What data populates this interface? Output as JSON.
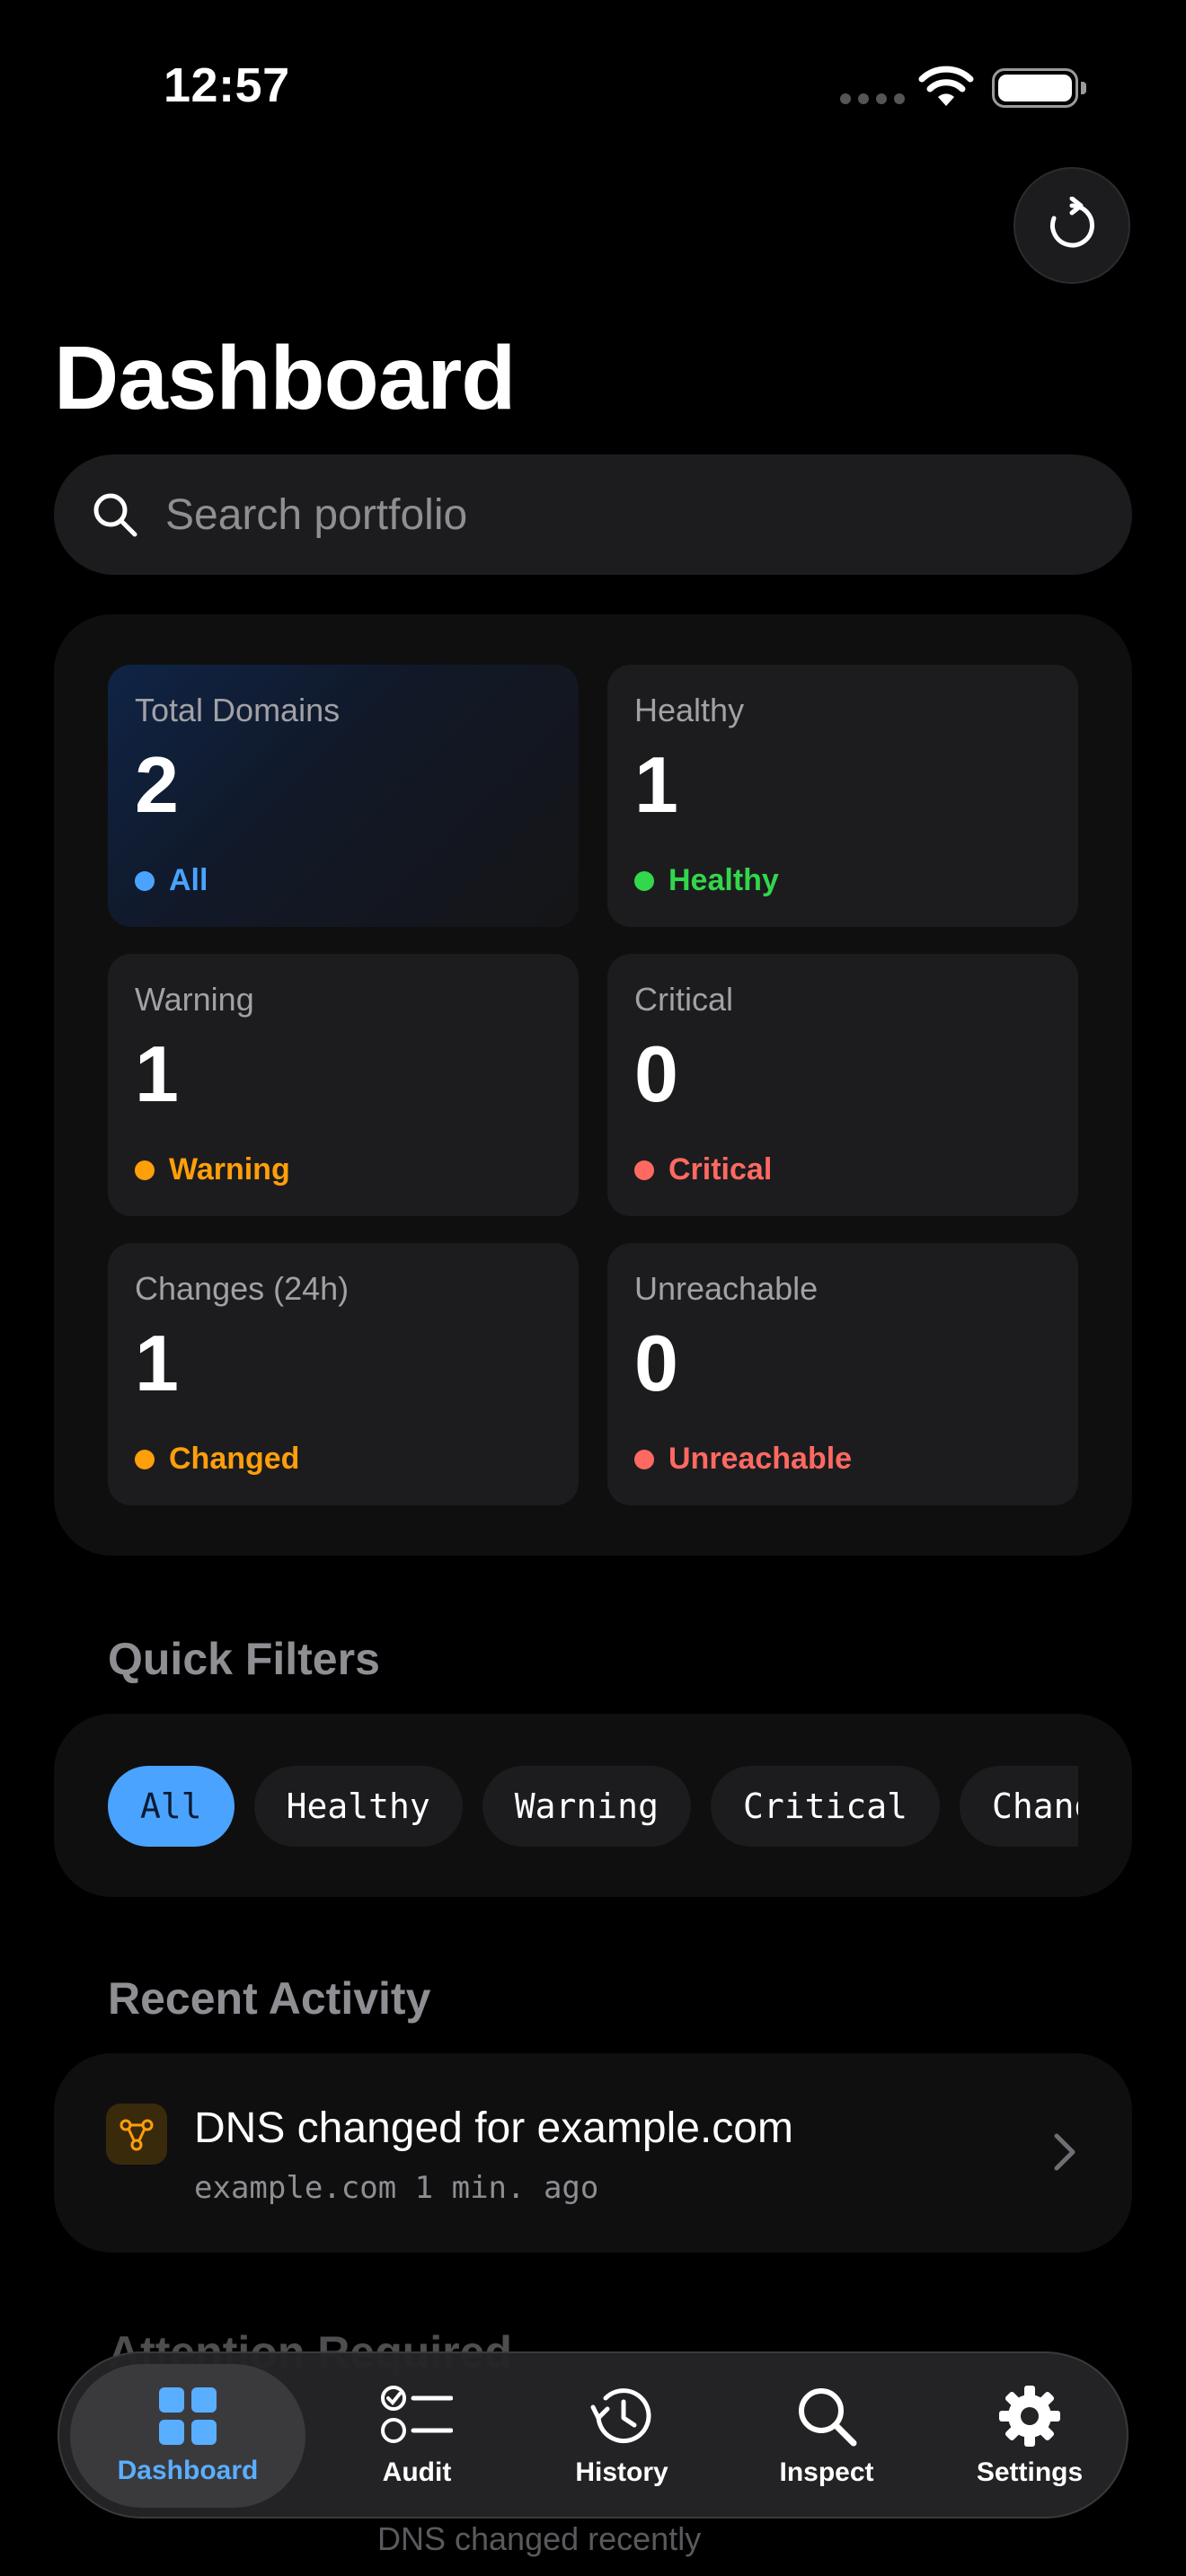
{
  "status_bar": {
    "time": "12:57"
  },
  "header": {
    "title": "Dashboard"
  },
  "search": {
    "placeholder": "Search portfolio"
  },
  "stats": [
    {
      "label": "Total Domains",
      "value": "2",
      "tag": "All",
      "color": "#4aa3ff"
    },
    {
      "label": "Healthy",
      "value": "1",
      "tag": "Healthy",
      "color": "#32d74b"
    },
    {
      "label": "Warning",
      "value": "1",
      "tag": "Warning",
      "color": "#ff9f0a"
    },
    {
      "label": "Critical",
      "value": "0",
      "tag": "Critical",
      "color": "#ff6961"
    },
    {
      "label": "Changes (24h)",
      "value": "1",
      "tag": "Changed",
      "color": "#ff9f0a"
    },
    {
      "label": "Unreachable",
      "value": "0",
      "tag": "Unreachable",
      "color": "#ff6961"
    }
  ],
  "quick_filters": {
    "title": "Quick Filters",
    "chips": [
      "All",
      "Healthy",
      "Warning",
      "Critical",
      "Changed"
    ],
    "active": "All"
  },
  "recent_activity": {
    "title": "Recent Activity",
    "items": [
      {
        "title": "DNS changed for example.com",
        "domain": "example.com",
        "time": "1 min. ago"
      }
    ]
  },
  "attention": {
    "title": "Attention Required",
    "sub": "DNS changed recently"
  },
  "tab_bar": {
    "tabs": [
      {
        "label": "Dashboard",
        "icon": "grid-icon"
      },
      {
        "label": "Audit",
        "icon": "checklist-icon"
      },
      {
        "label": "History",
        "icon": "history-icon"
      },
      {
        "label": "Inspect",
        "icon": "search-icon"
      },
      {
        "label": "Settings",
        "icon": "gear-icon"
      }
    ],
    "active": "Dashboard"
  },
  "colors": {
    "accent": "#4aa3ff",
    "healthy": "#32d74b",
    "warning": "#ff9f0a",
    "critical": "#ff6961"
  }
}
